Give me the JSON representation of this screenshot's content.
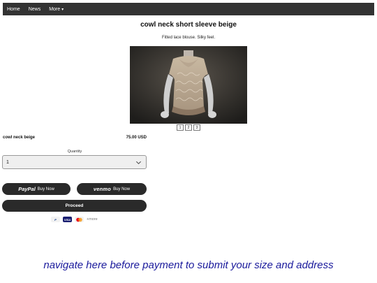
{
  "nav": {
    "items": [
      "Home",
      "News",
      "More"
    ],
    "more_caret": "▾"
  },
  "product": {
    "title": "cowl neck short sleeve beige",
    "description": "Fitted lace blouse. Silky feel.",
    "image_alt": "beige lace blouse on mannequin",
    "pages": [
      "1",
      "2",
      "3"
    ],
    "item_name": "cowl neck beige",
    "price": "75.00 USD"
  },
  "quantity": {
    "label": "Quantity",
    "value": "1"
  },
  "payment": {
    "paypal_logo": "PayPal",
    "paypal_label": "Buy Now",
    "venmo_logo": "venmo",
    "venmo_label": "Buy Now",
    "proceed_label": "Proceed",
    "methods": [
      "P",
      "VISA",
      "mc"
    ],
    "more_label": "+more"
  },
  "notice": "navigate here before payment to submit your size and address",
  "colors": {
    "navbar": "#333333",
    "button": "#2a2a2a",
    "notice": "#1a1a9c"
  }
}
